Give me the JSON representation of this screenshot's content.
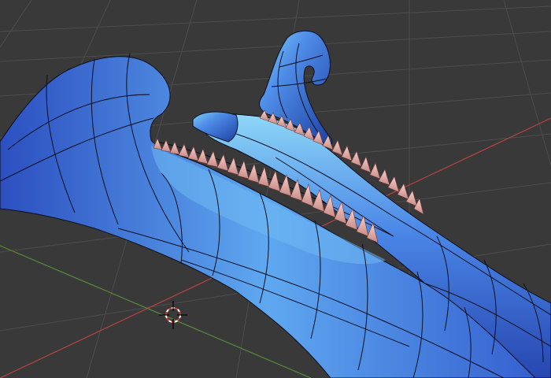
{
  "viewport": {
    "background": "#393939",
    "grid_color": "#4d4d4d",
    "x_axis_color": "#b84444",
    "y_axis_color": "#5a8a3a"
  },
  "mesh": {
    "object": "jaw-bone-mesh",
    "surface_color": "#4f8de8",
    "highlight_color": "#7fd0f5",
    "shadow_color": "#1c3fa0",
    "wire_color": "#0a0f1e",
    "teeth_color": "#e8aaa4"
  },
  "cursor": {
    "icon": "3d-cursor-icon",
    "ring_color_a": "#ffffff",
    "ring_color_b": "#d13a3a"
  }
}
